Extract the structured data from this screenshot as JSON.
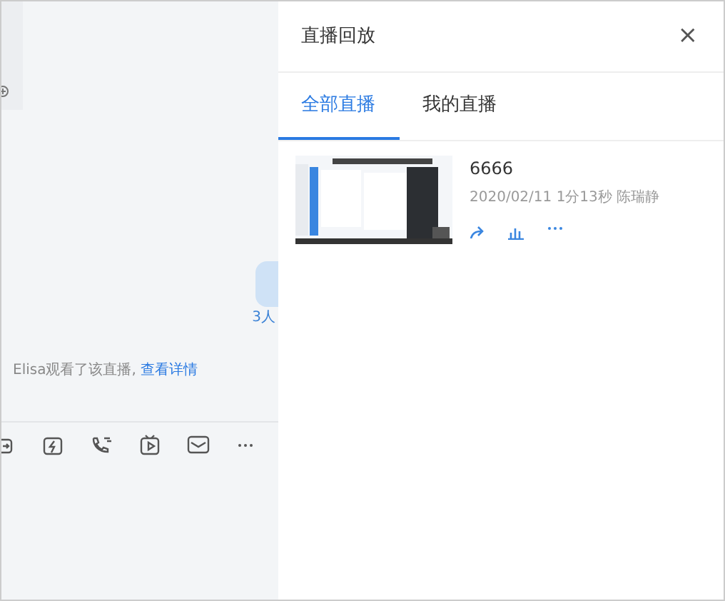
{
  "chat": {
    "read_count": "3人",
    "notice": {
      "text": "Elisa观看了该直播,",
      "link": "查看详情"
    }
  },
  "panel": {
    "title": "直播回放",
    "close": "×",
    "tabs": [
      {
        "label": "全部直播",
        "selected": true
      },
      {
        "label": "我的直播",
        "selected": false
      }
    ],
    "recordings": [
      {
        "kind": "picture",
        "title": "6666",
        "meta": "2020/02/11 1分13秒 陈瑞静"
      }
    ]
  }
}
